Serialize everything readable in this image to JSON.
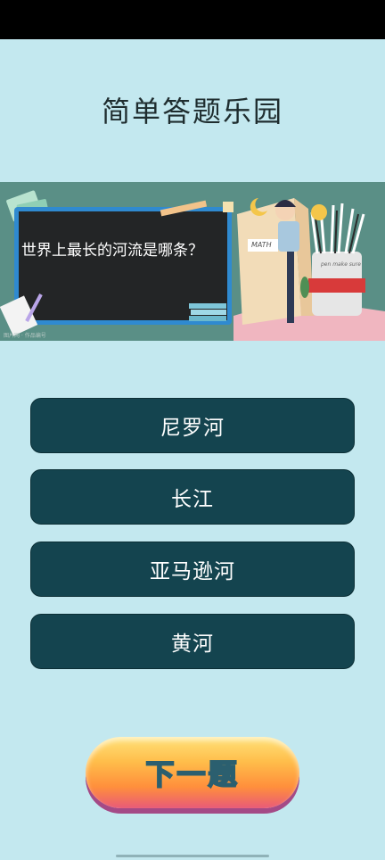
{
  "app": {
    "title": "简单答题乐园"
  },
  "question": {
    "text": "世界上最长的河流是哪条？",
    "banner_caption": "MATH",
    "cup_caption": "pen make sure",
    "watermark": "图片网 · 作品编号"
  },
  "options": [
    {
      "label": "尼罗河"
    },
    {
      "label": "长江"
    },
    {
      "label": "亚马逊河"
    },
    {
      "label": "黄河"
    }
  ],
  "actions": {
    "next_label": "下一题"
  },
  "colors": {
    "background": "#c3e8ef",
    "option_bg": "#14444f",
    "banner_bg": "#5a8f86"
  }
}
